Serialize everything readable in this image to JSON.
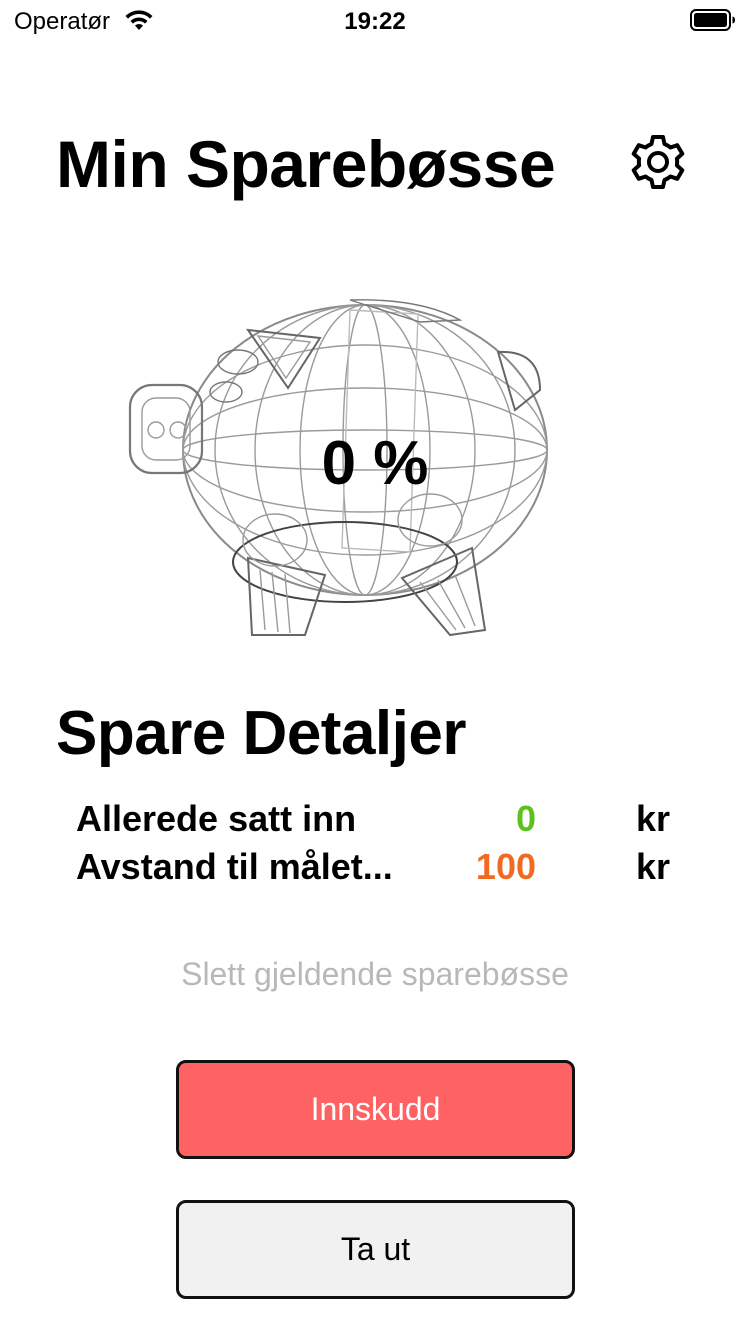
{
  "status_bar": {
    "carrier": "Operatør",
    "time": "19:22"
  },
  "header": {
    "title": "Min Sparebøsse",
    "settings_icon": "gear-icon"
  },
  "piggy": {
    "progress_text": "0 %",
    "progress_percent": 0
  },
  "details": {
    "title": "Spare Detaljer",
    "rows": [
      {
        "label": "Allerede satt inn",
        "value": "0",
        "unit": "kr",
        "color": "#5bc21c"
      },
      {
        "label": "Avstand til målet...",
        "value": "100",
        "unit": "kr",
        "color": "#f26a21"
      }
    ]
  },
  "actions": {
    "delete_label": "Slett gjeldende sparebøsse",
    "deposit_label": "Innskudd",
    "withdraw_label": "Ta ut"
  },
  "colors": {
    "deposit_button": "#ff6262",
    "withdraw_button": "#f1f1f1",
    "delete_text": "#b8b8b8"
  }
}
